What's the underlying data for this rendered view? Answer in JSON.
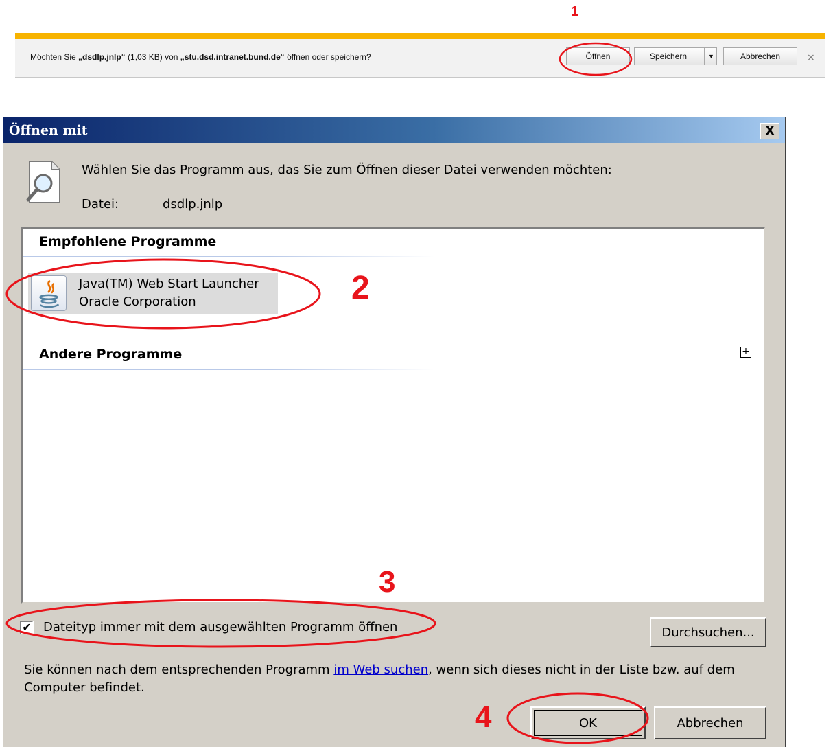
{
  "steps": {
    "s1": "1",
    "s2": "2",
    "s3": "3",
    "s4": "4"
  },
  "notification_bar": {
    "prefix": "Möchten Sie ",
    "file_name": "„dsdlp.jnlp“",
    "size": " (1,03 KB) von ",
    "host": "„stu.dsd.intranet.bund.de“",
    "suffix": " öffnen oder speichern?",
    "open_label": "Öffnen",
    "save_label": "Speichern",
    "cancel_label": "Abbrechen",
    "close_glyph": "×",
    "dropdown_glyph": "▼",
    "accent_color": "#f7b300"
  },
  "dialog": {
    "title": "Öffnen mit",
    "close_glyph": "X",
    "instruction": "Wählen Sie das Programm aus, das Sie zum Öffnen dieser Datei verwenden möchten:",
    "file_label": "Datei:",
    "file_name": "dsdlp.jnlp",
    "groups": {
      "recommended": "Empfohlene Programme",
      "other": "Andere Programme"
    },
    "expand_glyph": "+",
    "program": {
      "name": "Java(TM) Web Start Launcher",
      "vendor": "Oracle Corporation"
    },
    "checkbox_checked_glyph": "✔",
    "checkbox_label": "Dateityp immer mit dem ausgewählten Programm öffnen",
    "browse_label": "Durchsuchen...",
    "hint_before": "Sie können nach dem entsprechenden Programm ",
    "hint_link": "im Web suchen",
    "hint_after": ", wenn sich dieses nicht in der Liste bzw. auf dem Computer befindet.",
    "ok_label": "OK",
    "cancel_label": "Abbrechen",
    "titlebar_color": "#0a246a",
    "annotation_color": "#e8141b"
  }
}
